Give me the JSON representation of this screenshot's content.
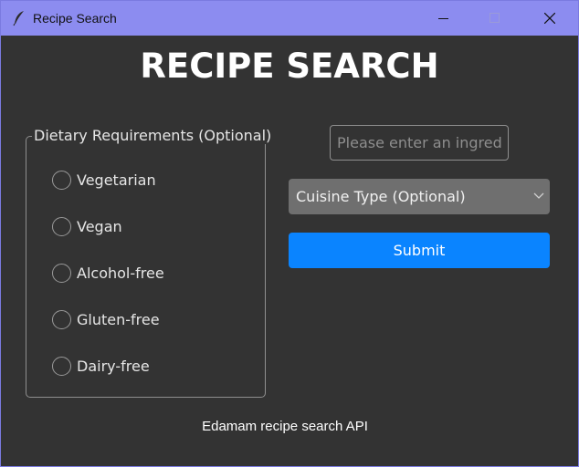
{
  "window": {
    "title": "Recipe Search",
    "icons": {
      "app": "feather-icon",
      "minimize": "minimize-icon",
      "maximize": "maximize-icon",
      "close": "close-icon"
    }
  },
  "heading": "RECIPE SEARCH",
  "dietary": {
    "legend": "Dietary Requirements (Optional)",
    "options": [
      "Vegetarian",
      "Vegan",
      "Alcohol-free",
      "Gluten-free",
      "Dairy-free"
    ]
  },
  "search": {
    "placeholder": "Please enter an ingredient",
    "value": ""
  },
  "cuisine": {
    "selected": "Cuisine Type (Optional)"
  },
  "submit": {
    "label": "Submit"
  },
  "footer": "Edamam recipe search API",
  "colors": {
    "background": "#333333",
    "titlebar": "#8c8cf0",
    "submit": "#0a84ff",
    "select": "#6f6f6f",
    "text": "#ffffff"
  }
}
